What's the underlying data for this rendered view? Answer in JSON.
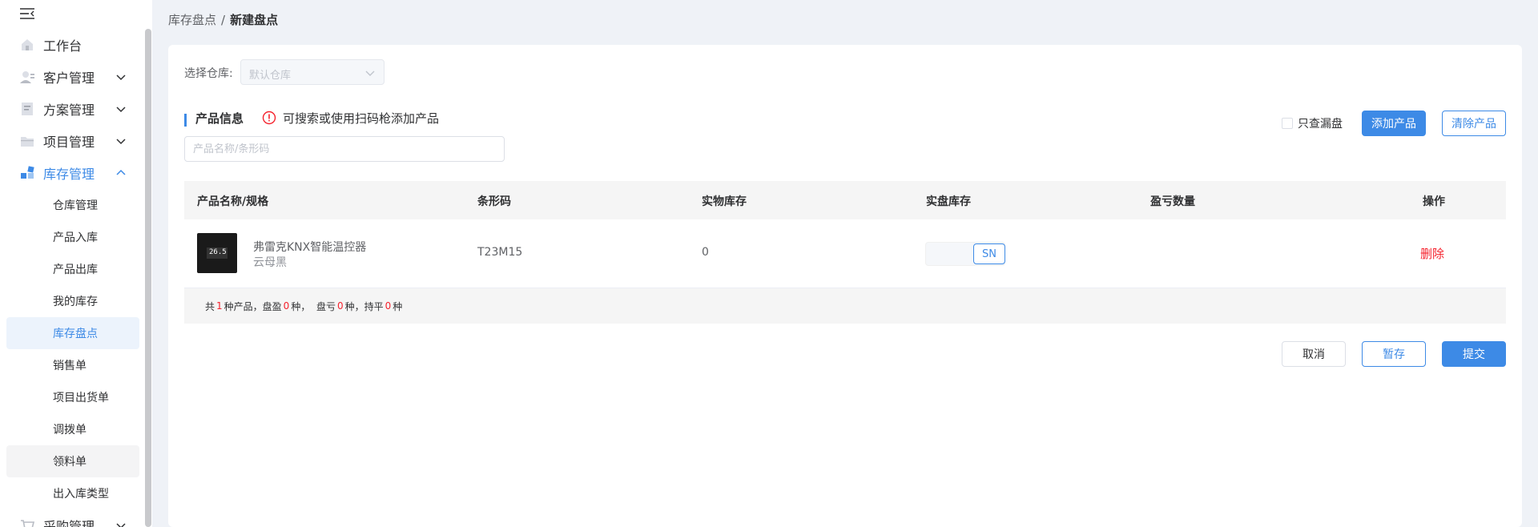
{
  "sidebar": {
    "menu": [
      {
        "label": "工作台",
        "icon": "home-icon",
        "has_children": false
      },
      {
        "label": "客户管理",
        "icon": "customer-icon",
        "has_children": true
      },
      {
        "label": "方案管理",
        "icon": "document-icon",
        "has_children": true
      },
      {
        "label": "项目管理",
        "icon": "folder-icon",
        "has_children": true
      },
      {
        "label": "库存管理",
        "icon": "inventory-icon",
        "has_children": true,
        "expanded": true
      }
    ],
    "submenu": [
      "仓库管理",
      "产品入库",
      "产品出库",
      "我的库存",
      "库存盘点",
      "销售单",
      "项目出货单",
      "调拨单",
      "领料单",
      "出入库类型"
    ],
    "selected_submenu": "库存盘点",
    "partial_item": {
      "label": "采购管理",
      "icon": "cart-icon"
    }
  },
  "breadcrumb": {
    "prev": "库存盘点",
    "sep": "/",
    "current": "新建盘点"
  },
  "warehouse": {
    "label": "选择仓库:",
    "placeholder": "默认仓库"
  },
  "section": {
    "title": "产品信息",
    "hint": "可搜索或使用扫码枪添加产品"
  },
  "search": {
    "placeholder": "产品名称/条形码"
  },
  "actions": {
    "only_missing": "只查漏盘",
    "add_product": "添加产品",
    "clear_products": "清除产品"
  },
  "table": {
    "headers": [
      "产品名称/规格",
      "条形码",
      "实物库存",
      "实盘库存",
      "盈亏数量",
      "操作"
    ],
    "rows": [
      {
        "name": "弗雷克KNX智能温控器",
        "spec": "云母黑",
        "thumb_text": "26.5",
        "barcode": "T23M15",
        "physical_stock": "0",
        "counted_stock": "",
        "sn_label": "SN",
        "diff": "",
        "action": "删除"
      }
    ],
    "summary": {
      "t1": "共",
      "n1": "1",
      "t2": "种产品，盘盈",
      "n2": "0",
      "t3": "种，  盘亏",
      "n3": "0",
      "t4": "种，持平",
      "n4": "0",
      "t5": "种"
    }
  },
  "footer_buttons": {
    "cancel": "取消",
    "save": "暂存",
    "submit": "提交"
  },
  "colors": {
    "primary": "#3d8ae6",
    "danger": "#f5222d"
  }
}
